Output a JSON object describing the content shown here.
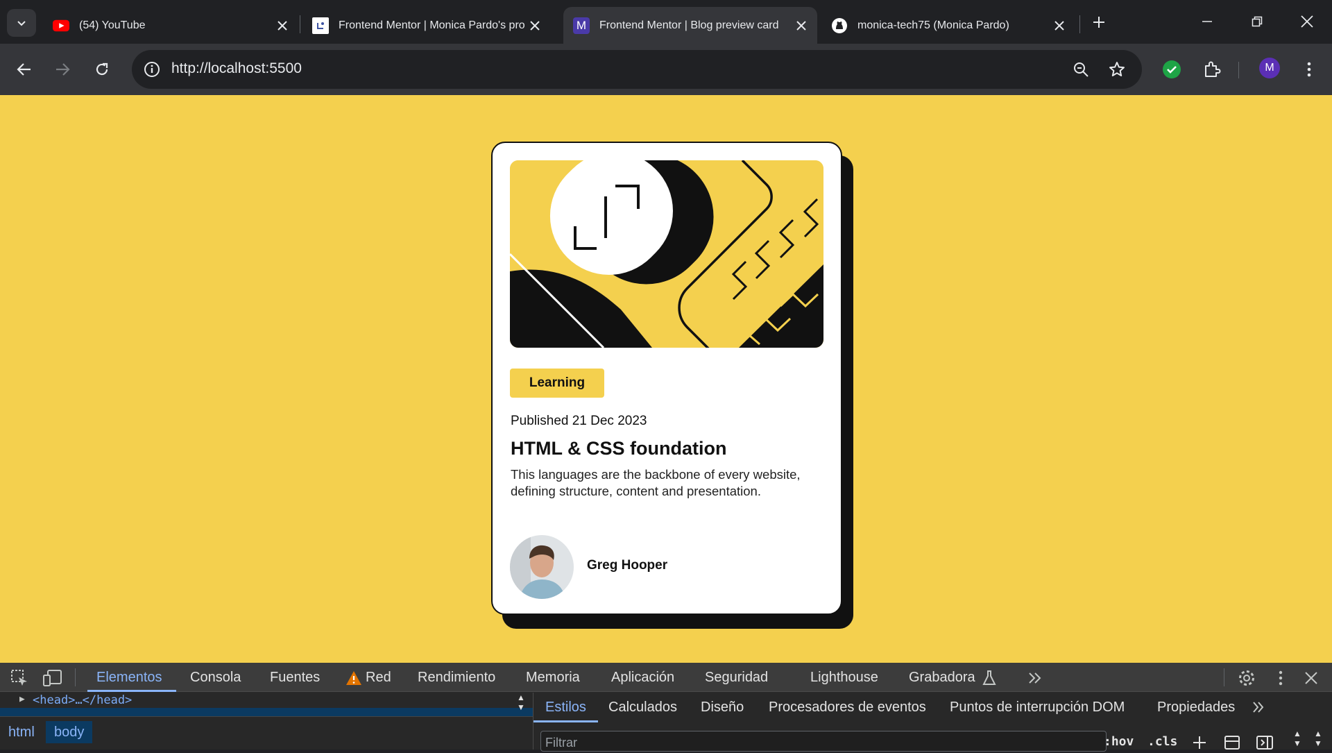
{
  "browser": {
    "tabs": [
      {
        "title": "(54) YouTube",
        "icon": "youtube-icon"
      },
      {
        "title": "Frontend Mentor | Monica Pardo's pro",
        "icon": "frontend-mentor-icon"
      },
      {
        "title": "Frontend Mentor | Blog preview card",
        "icon": "m-icon",
        "active": true
      },
      {
        "title": "monica-tech75 (Monica Pardo)",
        "icon": "github-icon"
      }
    ],
    "url": "http://localhost:5500",
    "profile_initial": "M",
    "m_favicon_letter": "M"
  },
  "card": {
    "tag": "Learning",
    "published": "Published 21 Dec 2023",
    "title": "HTML & CSS foundation",
    "description": "This languages are the backbone of every website, defining structure, content and presentation.",
    "author": "Greg Hooper",
    "colors": {
      "accent": "#f4d04e",
      "ink": "#111111",
      "card": "#ffffff"
    }
  },
  "devtools": {
    "tabs": [
      "Elementos",
      "Consola",
      "Fuentes",
      "Red",
      "Rendimiento",
      "Memoria",
      "Aplicación",
      "Seguridad",
      "Lighthouse",
      "Grabadora"
    ],
    "elements_line": "<head>…</head>",
    "breadcrumbs": [
      "html",
      "body"
    ],
    "subtabs": [
      "Estilos",
      "Calculados",
      "Diseño",
      "Procesadores de eventos",
      "Puntos de interrupción DOM",
      "Propiedades"
    ],
    "filter_placeholder": "Filtrar",
    "hov": ":hov",
    "cls": ".cls"
  }
}
